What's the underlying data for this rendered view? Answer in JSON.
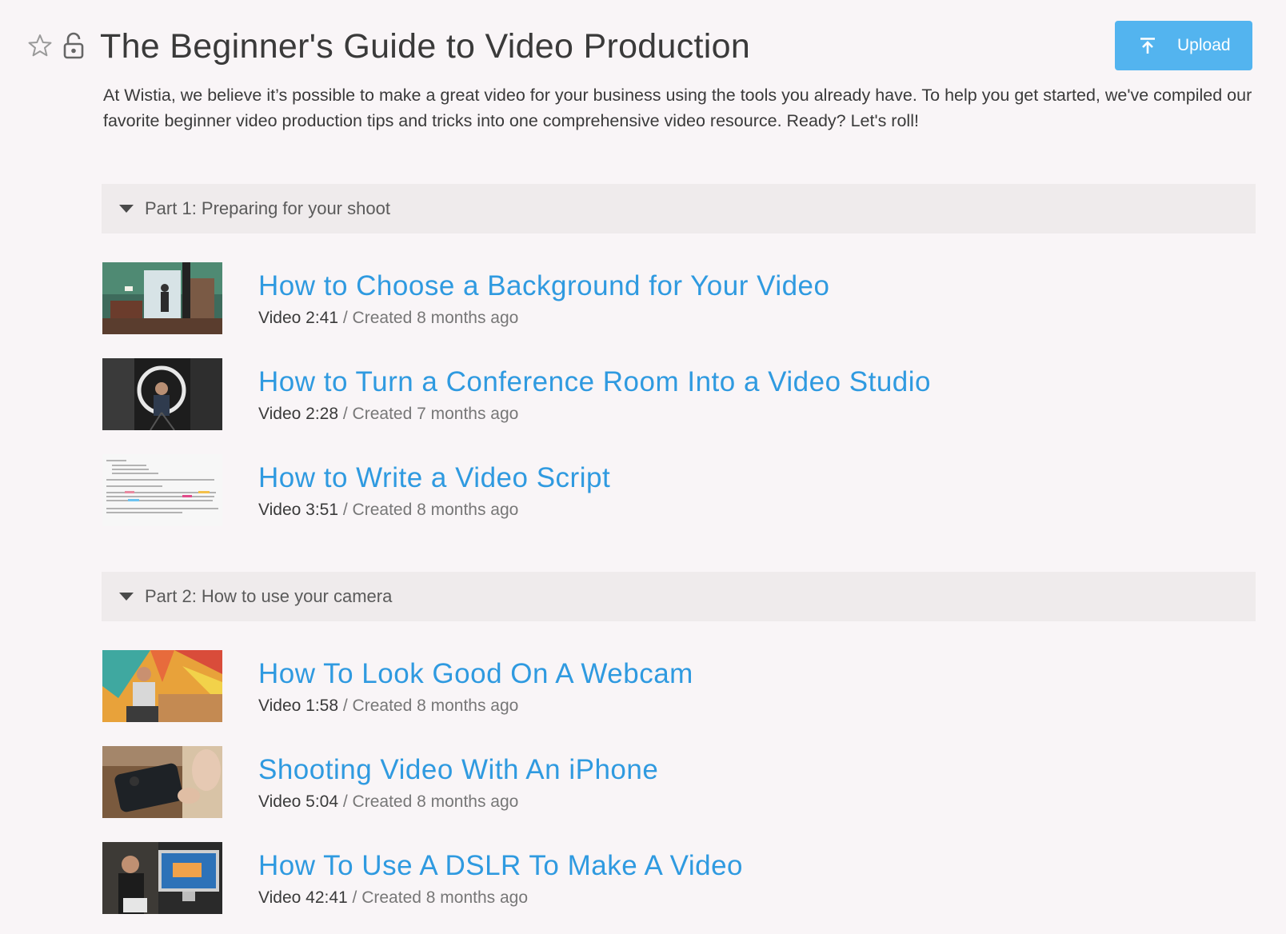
{
  "header": {
    "title": "The Beginner's Guide to Video Production",
    "upload_label": "Upload",
    "description": "At Wistia, we believe it’s possible to make a great video for your business using the tools you already have. To help you get started, we've compiled our favorite beginner video production tips and tricks into one comprehensive video resource. Ready? Let's roll!"
  },
  "sections": [
    {
      "title": "Part 1: Preparing for your shoot",
      "items": [
        {
          "title": "How to Choose a Background for Your Video",
          "kind_duration": "Video 2:41",
          "created": " / Created 8 months ago"
        },
        {
          "title": "How to Turn a Conference Room Into a Video Studio",
          "kind_duration": "Video 2:28",
          "created": " / Created 7 months ago"
        },
        {
          "title": "How to Write a Video Script",
          "kind_duration": "Video 3:51",
          "created": " / Created 8 months ago"
        }
      ]
    },
    {
      "title": "Part 2: How to use your camera",
      "items": [
        {
          "title": "How To Look Good On A Webcam",
          "kind_duration": "Video 1:58",
          "created": " / Created 8 months ago"
        },
        {
          "title": "Shooting Video With An iPhone",
          "kind_duration": "Video 5:04",
          "created": " / Created 8 months ago"
        },
        {
          "title": "How To Use A DSLR To Make A Video",
          "kind_duration": "Video 42:41",
          "created": " / Created 8 months ago"
        }
      ]
    }
  ],
  "colors": {
    "accent": "#53b4ef",
    "link": "#2f9ae0",
    "background": "#f9f5f7",
    "section_header_bg": "#efebec"
  }
}
